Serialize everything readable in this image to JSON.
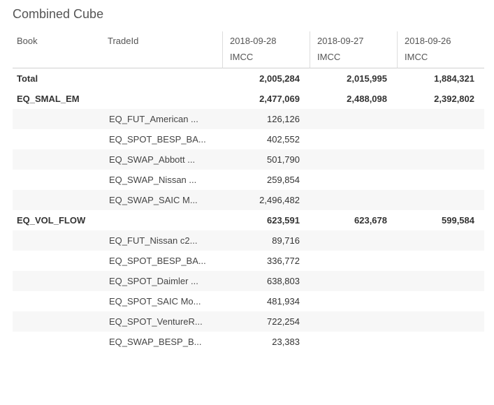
{
  "title": "Combined Cube",
  "columns": {
    "book": "Book",
    "tradeId": "TradeId",
    "dates": [
      "2018-09-28",
      "2018-09-27",
      "2018-09-26"
    ],
    "measure": "IMCC"
  },
  "total": {
    "label": "Total",
    "values": [
      "2,005,284",
      "2,015,995",
      "1,884,321"
    ]
  },
  "groups": [
    {
      "book": "EQ_SMAL_EM",
      "values": [
        "2,477,069",
        "2,488,098",
        "2,392,802"
      ],
      "rows": [
        {
          "tradeId": "EQ_FUT_American ...",
          "values": [
            "126,126",
            "",
            ""
          ]
        },
        {
          "tradeId": "EQ_SPOT_BESP_BA...",
          "values": [
            "402,552",
            "",
            ""
          ]
        },
        {
          "tradeId": "EQ_SWAP_Abbott ...",
          "values": [
            "501,790",
            "",
            ""
          ]
        },
        {
          "tradeId": "EQ_SWAP_Nissan ...",
          "values": [
            "259,854",
            "",
            ""
          ]
        },
        {
          "tradeId": "EQ_SWAP_SAIC M...",
          "values": [
            "2,496,482",
            "",
            ""
          ]
        }
      ]
    },
    {
      "book": "EQ_VOL_FLOW",
      "values": [
        "623,591",
        "623,678",
        "599,584"
      ],
      "rows": [
        {
          "tradeId": "EQ_FUT_Nissan c2...",
          "values": [
            "89,716",
            "",
            ""
          ]
        },
        {
          "tradeId": "EQ_SPOT_BESP_BA...",
          "values": [
            "336,772",
            "",
            ""
          ]
        },
        {
          "tradeId": "EQ_SPOT_Daimler ...",
          "values": [
            "638,803",
            "",
            ""
          ]
        },
        {
          "tradeId": "EQ_SPOT_SAIC Mo...",
          "values": [
            "481,934",
            "",
            ""
          ]
        },
        {
          "tradeId": "EQ_SPOT_VentureR...",
          "values": [
            "722,254",
            "",
            ""
          ]
        },
        {
          "tradeId": "EQ_SWAP_BESP_B...",
          "values": [
            "23,383",
            "",
            ""
          ]
        }
      ]
    }
  ]
}
